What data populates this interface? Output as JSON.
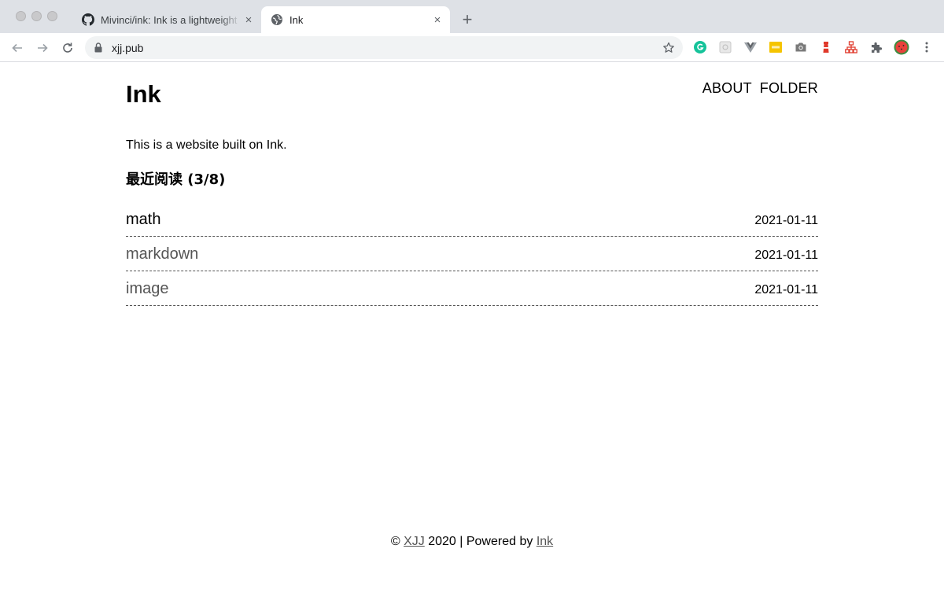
{
  "browser": {
    "tabs": [
      {
        "title": "Mivinci/ink: Ink is a lightweight",
        "icon": "github-icon",
        "active": false
      },
      {
        "title": "Ink",
        "icon": "globe-icon",
        "active": true
      }
    ],
    "close_glyph": "×",
    "new_tab_glyph": "+",
    "url": "xjj.pub",
    "extensions": [
      "grammarly-icon",
      "extension-grid-icon",
      "vue-devtools-icon",
      "extension-yellow-icon",
      "camera-icon",
      "lighthouse-icon",
      "org-chart-icon",
      "puzzle-icon",
      "watermelon-avatar-icon"
    ]
  },
  "site": {
    "title": "Ink",
    "nav": [
      {
        "label": "ABOUT"
      },
      {
        "label": "FOLDER"
      }
    ],
    "intro": "This is a website built on Ink.",
    "recent_heading": "最近阅读 (3/8)",
    "posts": [
      {
        "title": "math",
        "date": "2021-01-11",
        "color": "#000000"
      },
      {
        "title": "markdown",
        "date": "2021-01-11",
        "color": "#555555"
      },
      {
        "title": "image",
        "date": "2021-01-11",
        "color": "#555555"
      }
    ]
  },
  "footer": {
    "copyright": "©",
    "author": "XJJ",
    "year_text": "2020 | Powered by",
    "powered_link": "Ink"
  }
}
